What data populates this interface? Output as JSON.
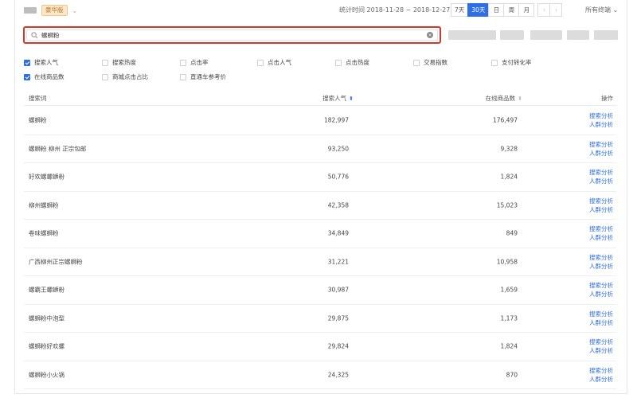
{
  "header": {
    "edition_badge": "豪华版",
    "date_label": "统计时间 2018-11-28 ~ 2018-12-27",
    "ranges": [
      "7天",
      "30天",
      "日",
      "周",
      "月"
    ],
    "active_range": "30天",
    "prev_arrow": "‹",
    "next_arrow": "›",
    "terminal": "所有终端 ⌄"
  },
  "search": {
    "value": "螺蛳粉",
    "clear_glyph": "×"
  },
  "metrics": [
    {
      "label": "搜索人气",
      "checked": true
    },
    {
      "label": "搜索热度",
      "checked": false
    },
    {
      "label": "点击率",
      "checked": false
    },
    {
      "label": "点击人气",
      "checked": false
    },
    {
      "label": "点击热度",
      "checked": false
    },
    {
      "label": "交易指数",
      "checked": false
    },
    {
      "label": "支付转化率",
      "checked": false
    },
    {
      "label": "在线商品数",
      "checked": true
    },
    {
      "label": "商城点击占比",
      "checked": false
    },
    {
      "label": "直通车参考价",
      "checked": false
    }
  ],
  "table": {
    "headers": {
      "term": "搜索词",
      "popularity": "搜索人气",
      "popularity_sort": "⬍",
      "products": "在线商品数",
      "products_sort": "⬍",
      "ops": "操作"
    },
    "op_links": [
      "搜索分析",
      "人群分析"
    ],
    "rows": [
      {
        "term": "螺蛳粉",
        "popularity": "182,997",
        "products": "176,497"
      },
      {
        "term": "螺蛳粉 柳州 正宗包邮",
        "popularity": "93,250",
        "products": "9,328"
      },
      {
        "term": "好欢螺螺蛳粉",
        "popularity": "50,776",
        "products": "1,824"
      },
      {
        "term": "柳州螺蛳粉",
        "popularity": "42,358",
        "products": "15,023"
      },
      {
        "term": "卷味螺蛳粉",
        "popularity": "34,849",
        "products": "849"
      },
      {
        "term": "广西柳州正宗螺蛳粉",
        "popularity": "31,221",
        "products": "10,958"
      },
      {
        "term": "螺霸王螺蛳粉",
        "popularity": "30,987",
        "products": "1,659"
      },
      {
        "term": "螺蛳粉中泡型",
        "popularity": "29,875",
        "products": "1,173"
      },
      {
        "term": "螺蛳粉好欢螺",
        "popularity": "29,824",
        "products": "1,824"
      },
      {
        "term": "螺蛳粉小火锅",
        "popularity": "24,325",
        "products": "870"
      }
    ]
  },
  "colors": {
    "accent": "#2f6fe6",
    "highlight_border": "#d9362b",
    "badge_bg": "#fbe7c9",
    "badge_text": "#b9772a"
  }
}
